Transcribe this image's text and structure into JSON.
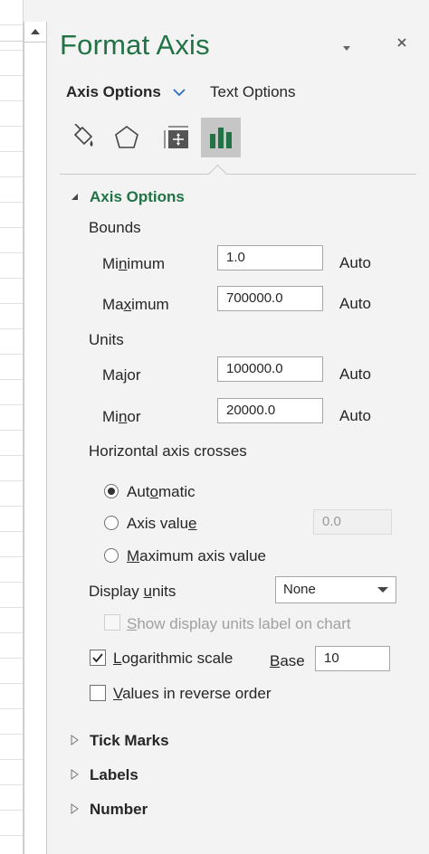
{
  "pane": {
    "title": "Format Axis",
    "tabs": {
      "axis_options": "Axis Options",
      "text_options": "Text Options"
    },
    "category_icons": [
      "fill-line-icon",
      "effects-icon",
      "size-properties-icon",
      "axis-options-icon"
    ]
  },
  "axis_options": {
    "header": "Axis Options",
    "bounds": {
      "label": "Bounds",
      "minimum": {
        "pre": "Mi",
        "key": "n",
        "post": "imum",
        "value": "1.0",
        "auto": "Auto"
      },
      "maximum": {
        "pre": "Ma",
        "key": "x",
        "post": "imum",
        "value": "700000.0",
        "auto": "Auto"
      }
    },
    "units": {
      "label": "Units",
      "major": {
        "label": "Major",
        "value": "100000.0",
        "auto": "Auto"
      },
      "minor": {
        "pre": "Mi",
        "key": "n",
        "post": "or",
        "value": "20000.0",
        "auto": "Auto"
      }
    },
    "crosses": {
      "label": "Horizontal axis crosses",
      "automatic": {
        "pre": "Aut",
        "key": "o",
        "post": "matic",
        "checked": true
      },
      "axis_value": {
        "pre": "Axis valu",
        "key": "e",
        "post": "",
        "value": "0.0",
        "checked": false
      },
      "max_axis_value": {
        "pre": "",
        "key": "M",
        "post": "aximum axis value",
        "checked": false
      }
    },
    "display_units": {
      "pre": "Display ",
      "key": "u",
      "post": "nits",
      "selected": "None",
      "show_label": {
        "pre": "",
        "key": "S",
        "post": "how display units label on chart",
        "checked": false
      }
    },
    "log_scale": {
      "pre": "",
      "key": "L",
      "post": "ogarithmic scale",
      "checked": true,
      "base_pre": "",
      "base_key": "B",
      "base_post": "ase",
      "base_value": "10"
    },
    "reverse": {
      "pre": "",
      "key": "V",
      "post": "alues in reverse order",
      "checked": false
    }
  },
  "sections": {
    "tick_marks": "Tick Marks",
    "labels": "Labels",
    "number": "Number"
  },
  "colors": {
    "accent": "#217346",
    "background": "#f3f3f3",
    "selected_icon_bg": "#c6c6c6"
  }
}
